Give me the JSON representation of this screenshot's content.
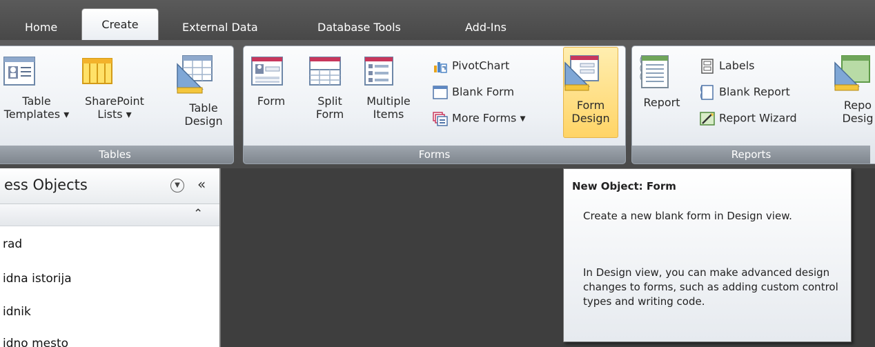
{
  "tabs": [
    {
      "label": "Home"
    },
    {
      "label": "Create",
      "active": true
    },
    {
      "label": "External Data"
    },
    {
      "label": "Database Tools"
    },
    {
      "label": "Add-Ins"
    }
  ],
  "ribbon": {
    "tables": {
      "label": "Tables",
      "buttons": [
        {
          "label": "Table\nTemplates ▾",
          "icon": "table-templates-icon"
        },
        {
          "label": "SharePoint\nLists ▾",
          "icon": "sharepoint-lists-icon"
        },
        {
          "label": "Table\nDesign",
          "icon": "table-design-icon"
        }
      ]
    },
    "forms": {
      "label": "Forms",
      "buttons": [
        {
          "label": "Form",
          "icon": "form-icon"
        },
        {
          "label": "Split\nForm",
          "icon": "split-form-icon"
        },
        {
          "label": "Multiple\nItems",
          "icon": "multiple-items-icon"
        },
        {
          "label": "Form\nDesign",
          "icon": "form-design-icon",
          "selected": true
        }
      ],
      "small_buttons": [
        {
          "label": "PivotChart",
          "icon": "pivotchart-icon"
        },
        {
          "label": "Blank Form",
          "icon": "blank-form-icon"
        },
        {
          "label": "More Forms ▾",
          "icon": "more-forms-icon"
        }
      ]
    },
    "reports": {
      "label": "Reports",
      "buttons": [
        {
          "label": "Report",
          "icon": "report-icon"
        },
        {
          "label": "Repo\nDesig",
          "icon": "report-design-icon"
        }
      ],
      "small_buttons": [
        {
          "label": "Labels",
          "icon": "labels-icon"
        },
        {
          "label": "Blank Report",
          "icon": "blank-report-icon"
        },
        {
          "label": "Report Wizard",
          "icon": "report-wizard-icon"
        }
      ]
    }
  },
  "navpane": {
    "title": "ess Objects",
    "items": [
      {
        "label": "rad"
      },
      {
        "label": "idna istorija"
      },
      {
        "label": "idnik"
      },
      {
        "label": "idno mesto"
      }
    ]
  },
  "tooltip": {
    "title": "New Object: Form",
    "paragraph1": "Create a new blank form in Design view.",
    "paragraph2": "In Design view, you can make advanced design changes to forms, such as adding custom control types and writing code."
  },
  "colors": {
    "ribbon_bg": "#4a4a4a",
    "group_bg": "#eef1f5",
    "group_label_bg": "#8a9199",
    "selected_bg": "#ffd466",
    "workarea_bg": "#3e3e3e"
  }
}
